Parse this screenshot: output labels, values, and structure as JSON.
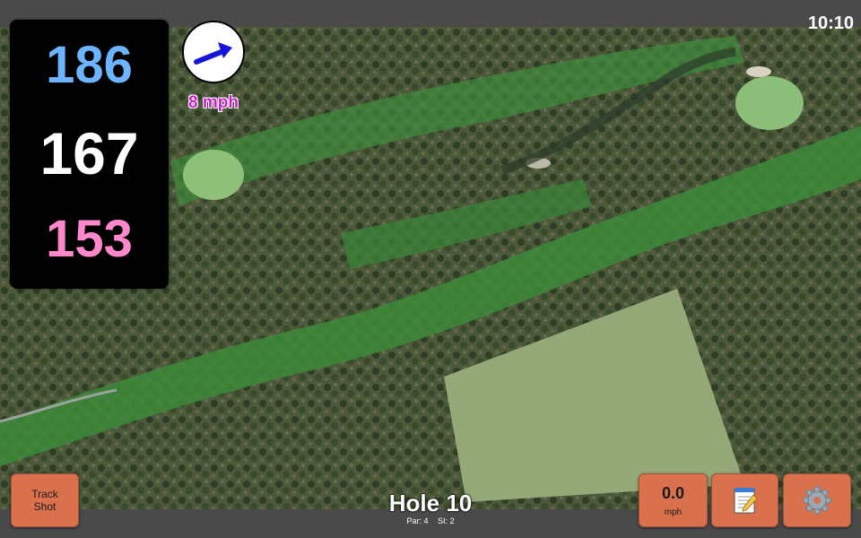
{
  "status": {
    "time": "10:10"
  },
  "yardages": {
    "back": "186",
    "center": "167",
    "front": "153"
  },
  "wind": {
    "speed": "8 mph",
    "direction_icon": "arrow-up-right-icon"
  },
  "hole": {
    "title": "Hole 10",
    "par": "Par: 4",
    "stroke_index": "SI: 2"
  },
  "buttons": {
    "track_shot_line1": "Track",
    "track_shot_line2": "Shot",
    "speed_value": "0.0",
    "speed_unit": "mph",
    "notes_icon": "notepad-icon",
    "settings_icon": "gear-icon"
  },
  "colors": {
    "back": "#6cb4ff",
    "center": "#ffffff",
    "front": "#ff88cc",
    "wind_text": "#cc22cc",
    "button": "#d9714c",
    "arrow": "#1414dd"
  }
}
